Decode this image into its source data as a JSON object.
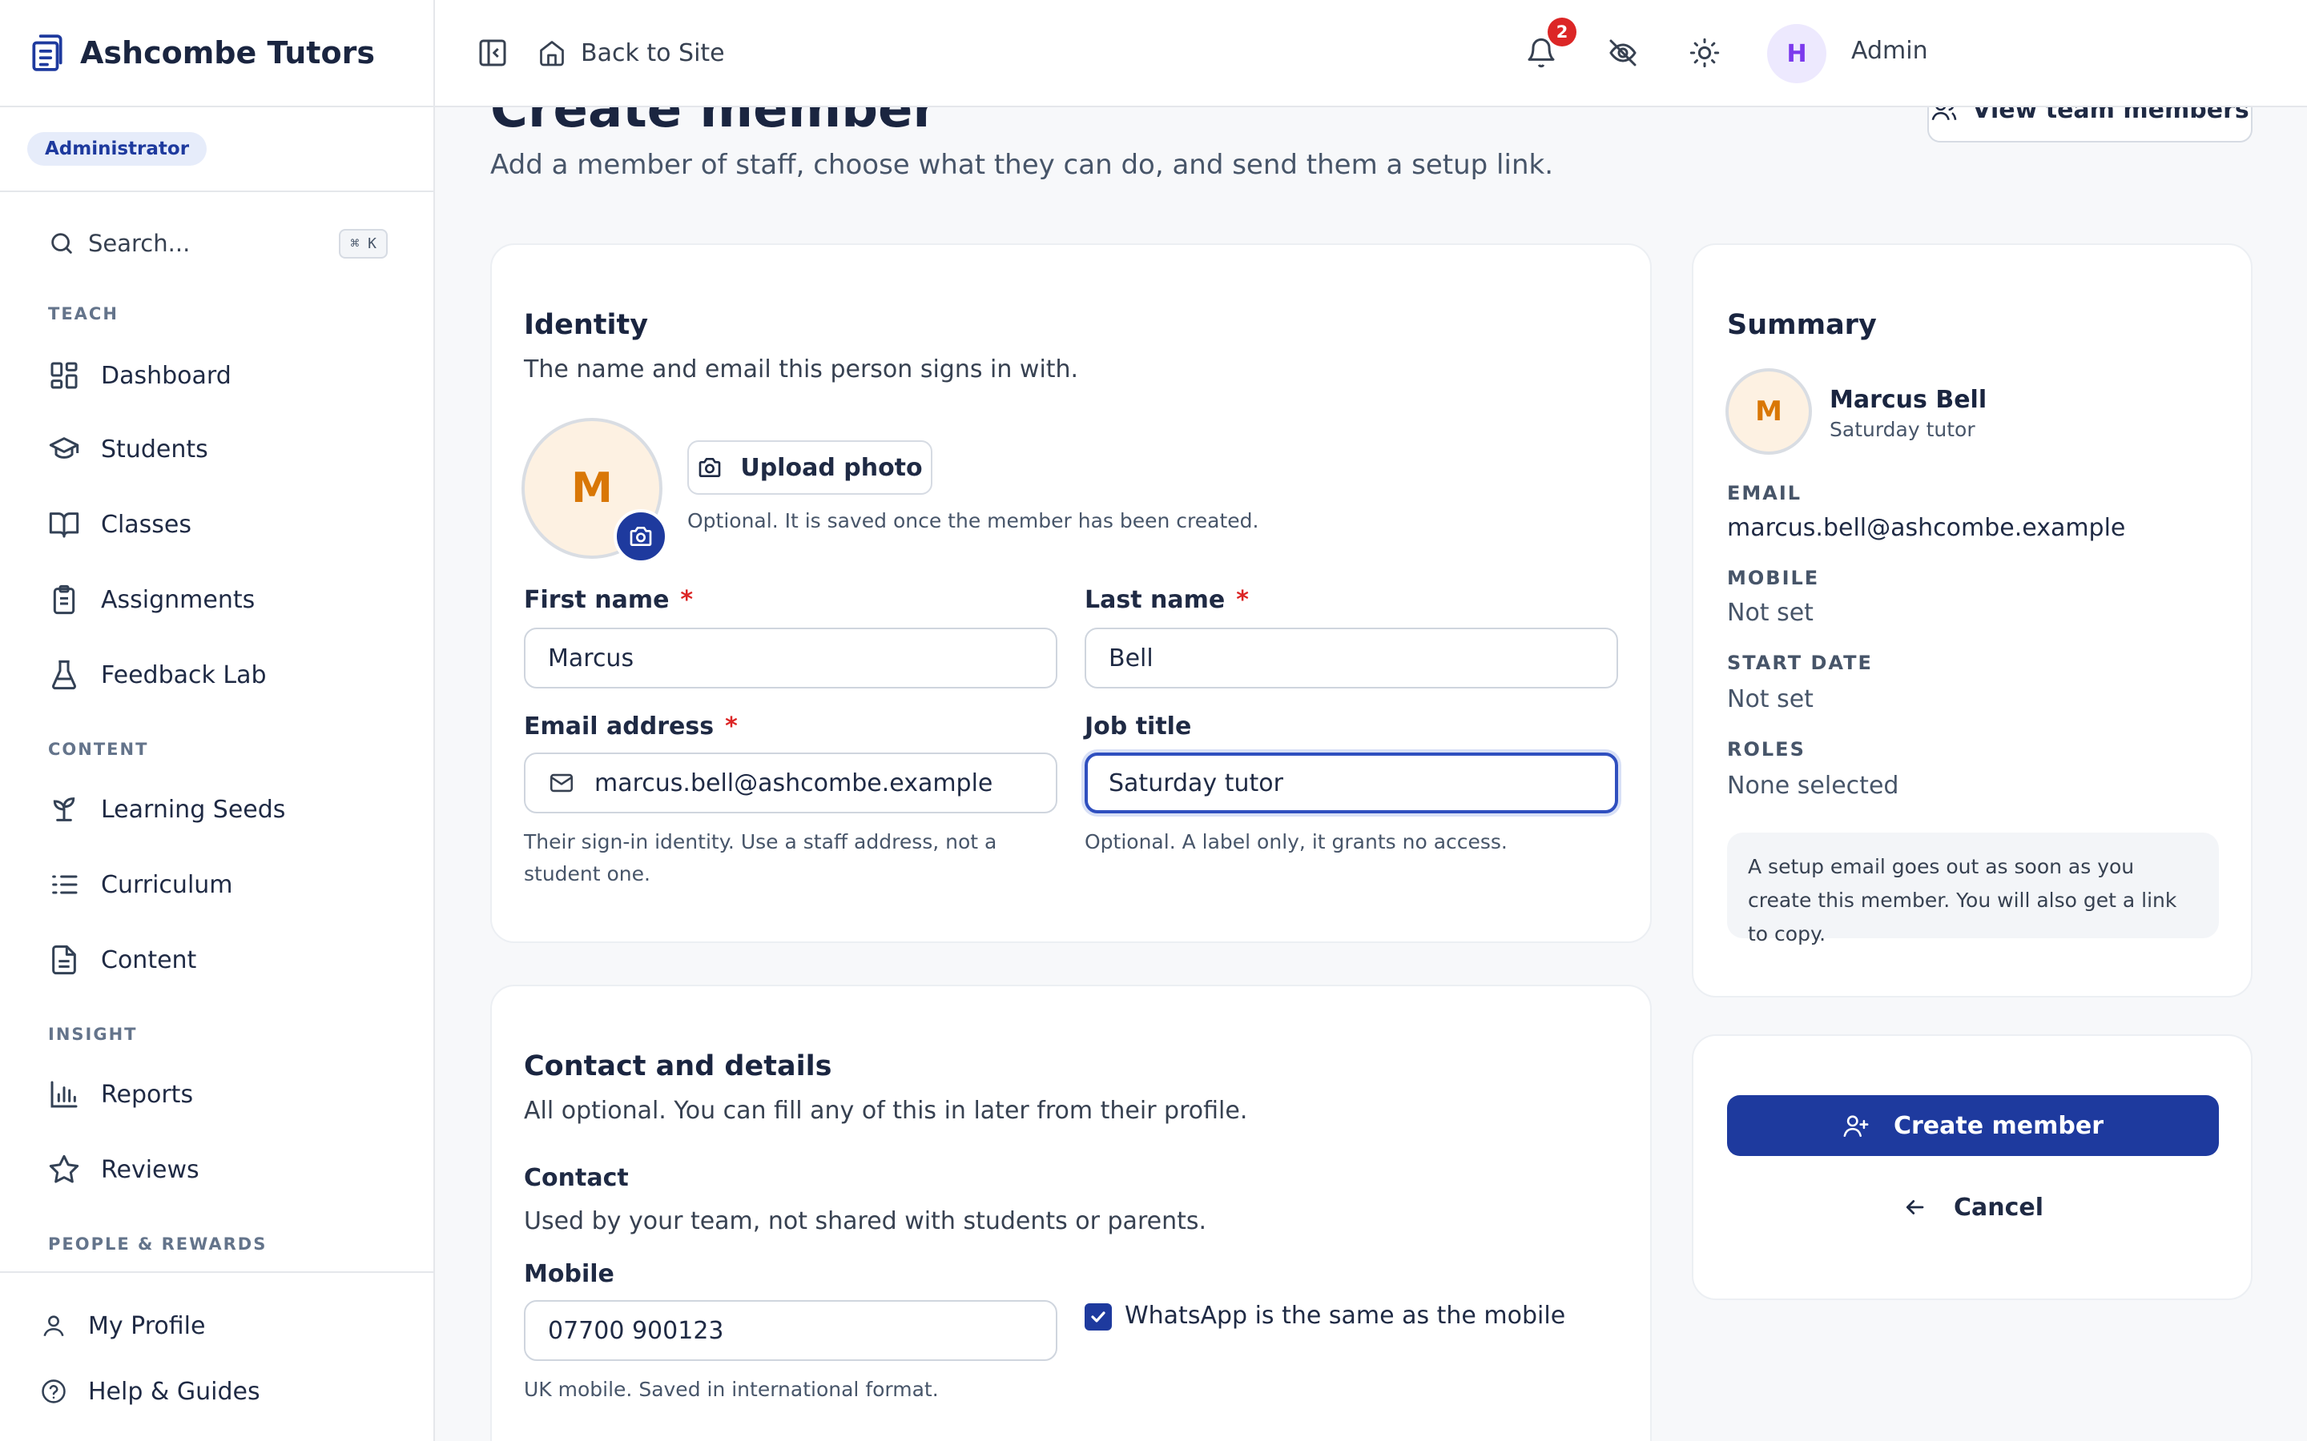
{
  "app": {
    "title": "Ashcombe Tutors",
    "role_badge": "Administrator"
  },
  "search": {
    "label": "Search...",
    "shortcut": "⌘ K"
  },
  "sidebar": {
    "sections": [
      {
        "heading": "TEACH",
        "items": [
          {
            "label": "Dashboard",
            "icon": "dashboard-icon"
          },
          {
            "label": "Students",
            "icon": "graduation-cap-icon"
          },
          {
            "label": "Classes",
            "icon": "book-open-icon"
          },
          {
            "label": "Assignments",
            "icon": "clipboard-list-icon"
          },
          {
            "label": "Feedback Lab",
            "icon": "flask-icon"
          }
        ]
      },
      {
        "heading": "CONTENT",
        "items": [
          {
            "label": "Learning Seeds",
            "icon": "sprout-icon"
          },
          {
            "label": "Curriculum",
            "icon": "list-ordered-icon"
          },
          {
            "label": "Content",
            "icon": "file-text-icon"
          }
        ]
      },
      {
        "heading": "INSIGHT",
        "items": [
          {
            "label": "Reports",
            "icon": "bar-chart-icon"
          },
          {
            "label": "Reviews",
            "icon": "star-icon"
          }
        ]
      },
      {
        "heading": "PEOPLE & REWARDS",
        "items": []
      }
    ],
    "bottom": [
      {
        "label": "My Profile",
        "icon": "user-icon"
      },
      {
        "label": "Help & Guides",
        "icon": "help-circle-icon"
      }
    ]
  },
  "topbar": {
    "back_label": "Back to Site",
    "user_label": "Admin",
    "notification_count": "2",
    "avatar_initial": "H"
  },
  "page": {
    "title": "Create member",
    "subtitle": "Add a member of staff, choose what they can do, and send them a setup link.",
    "view_team_label": "View team members"
  },
  "identity": {
    "title": "Identity",
    "description": "The name and email this person signs in with.",
    "avatar_initial": "M",
    "upload_label": "Upload photo",
    "upload_hint": "Optional. It is saved once the member has been created.",
    "first_name": {
      "label": "First name",
      "value": "Marcus"
    },
    "last_name": {
      "label": "Last name",
      "value": "Bell"
    },
    "email": {
      "label": "Email address",
      "value": "marcus.bell@ashcombe.example",
      "hint": "Their sign-in identity. Use a staff address, not a student one."
    },
    "job_title": {
      "label": "Job title",
      "value": "Saturday tutor",
      "hint": "Optional. A label only, it grants no access."
    },
    "required_mark": "*"
  },
  "contact": {
    "title": "Contact and details",
    "description": "All optional. You can fill any of this in later from their profile.",
    "subtitle": "Contact",
    "sub_description": "Used by your team, not shared with students or parents.",
    "mobile": {
      "label": "Mobile",
      "value": "07700 900123",
      "hint": "UK mobile. Saved in international format."
    },
    "whatsapp_label": "WhatsApp is the same as the mobile",
    "whatsapp_checked": true
  },
  "summary": {
    "title": "Summary",
    "avatar_initial": "M",
    "name": "Marcus Bell",
    "role": "Saturday tutor",
    "fields": [
      {
        "key": "EMAIL",
        "value": "marcus.bell@ashcombe.example"
      },
      {
        "key": "MOBILE",
        "value": "Not set"
      },
      {
        "key": "START DATE",
        "value": "Not set"
      },
      {
        "key": "ROLES",
        "value": "None selected"
      }
    ],
    "note": "A setup email goes out as soon as you create this member. You will also get a link to copy."
  },
  "actions": {
    "create_label": "Create member",
    "cancel_label": "Cancel"
  },
  "colors": {
    "primary": "#1e3a9e",
    "badge_red": "#dc2626",
    "avatar_orange": "#d97706"
  }
}
